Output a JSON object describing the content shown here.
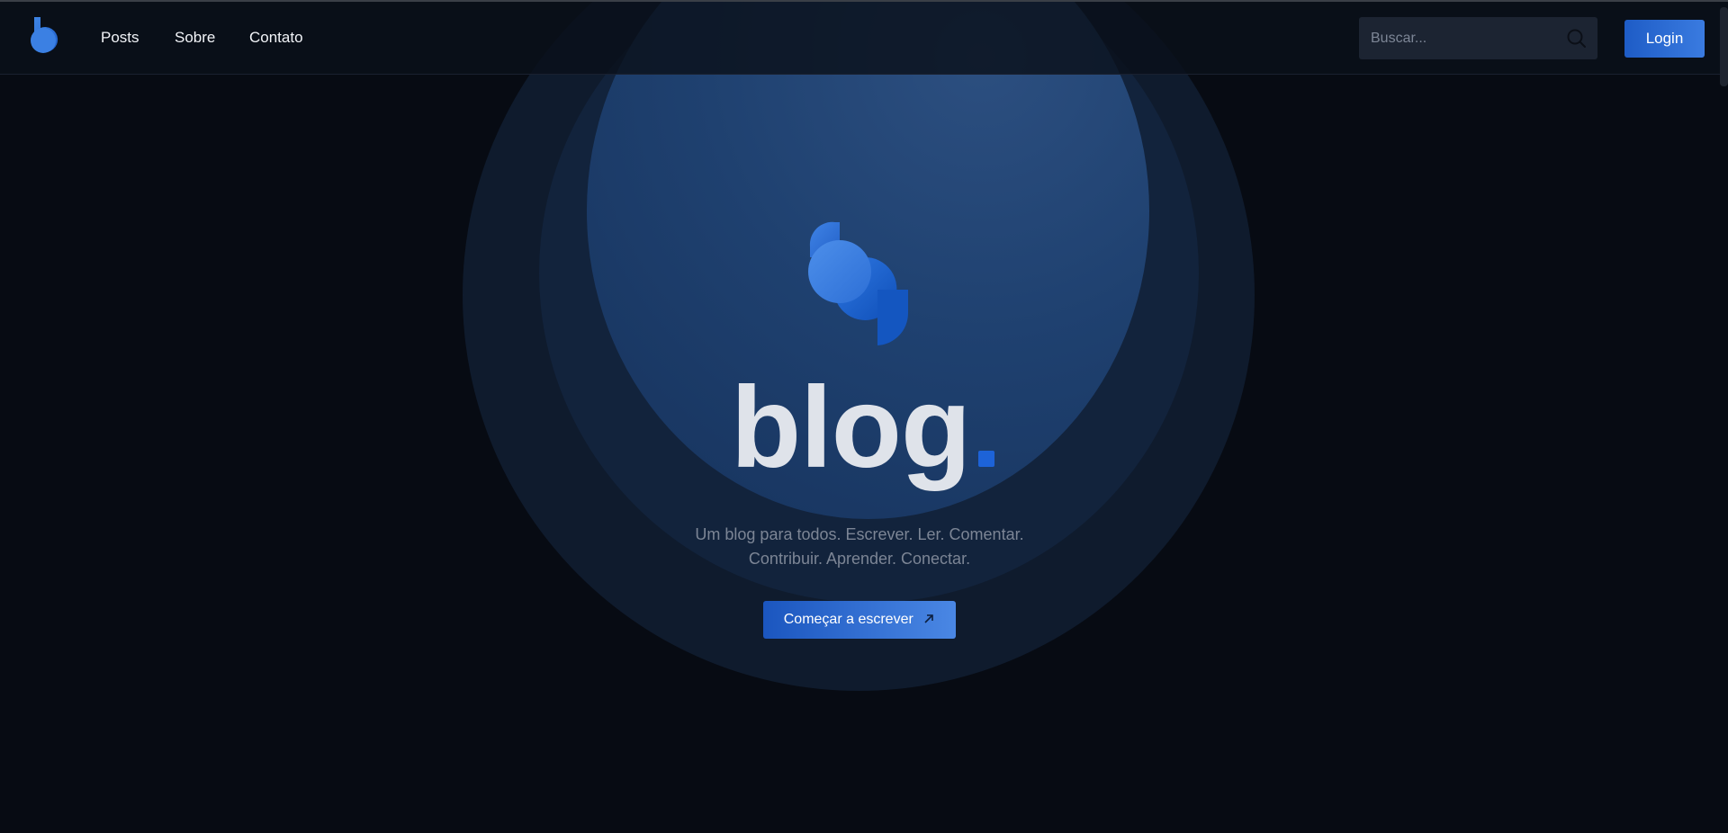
{
  "header": {
    "logo_icon": "blog-logo-icon",
    "nav": {
      "posts": "Posts",
      "sobre": "Sobre",
      "contato": "Contato"
    },
    "search": {
      "placeholder": "Buscar...",
      "value": "",
      "icon": "search-icon"
    },
    "login_label": "Login"
  },
  "hero": {
    "logo_icon": "blog-logo-icon",
    "title": "blog",
    "tagline_line1": "Um blog para todos. Escrever. Ler. Comentar.",
    "tagline_line2": "Contribuir. Aprender. Conectar.",
    "cta_label": "Começar a escrever",
    "cta_icon": "arrow-up-right-icon"
  },
  "colors": {
    "background": "#070b13",
    "accent": "#1d63d8",
    "text": "#dfe3ea",
    "muted_text": "#7c8595"
  }
}
